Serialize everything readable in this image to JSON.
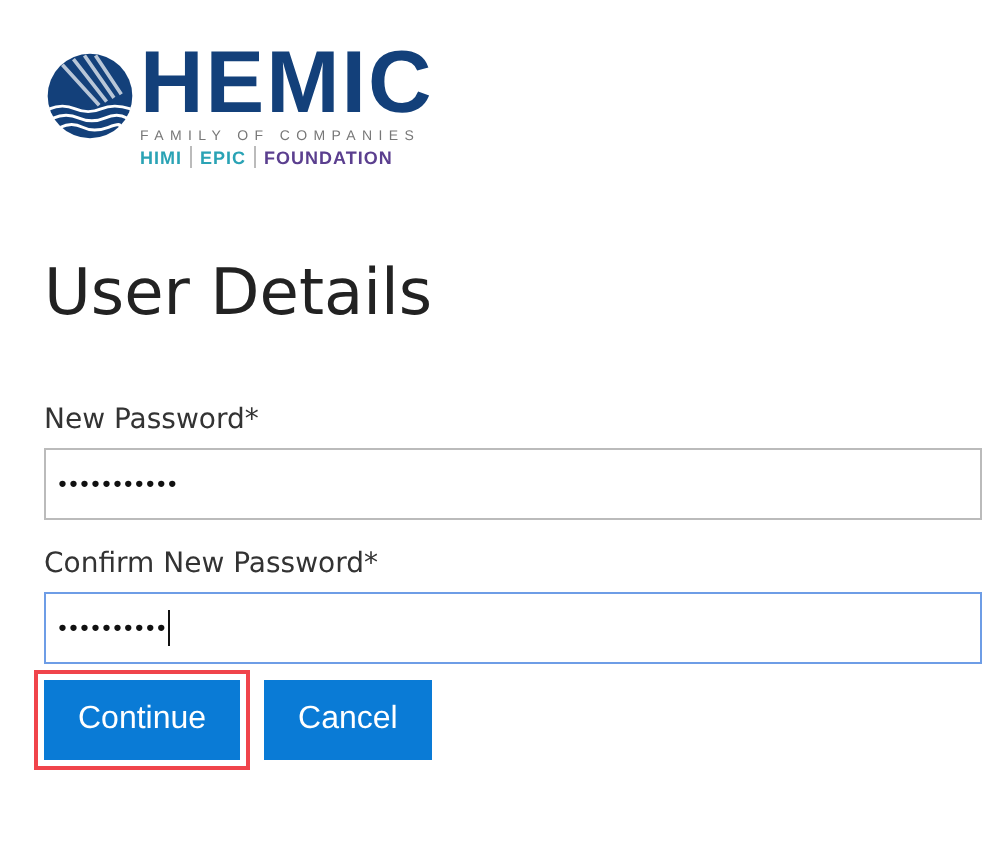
{
  "logo": {
    "name": "HEMIC",
    "tagline": "FAMILY OF COMPANIES",
    "brands": [
      {
        "label": "HIMI",
        "color": "#2aa3b5"
      },
      {
        "label": "EPIC",
        "color": "#2aa3b5"
      },
      {
        "label": "FOUNDATION",
        "color": "#5b3f8f"
      }
    ]
  },
  "title": "User Details",
  "fields": [
    {
      "label": "New Password*",
      "value": "•••••••••••",
      "focused": false
    },
    {
      "label": "Confirm New Password*",
      "value": "••••••••••",
      "focused": true
    }
  ],
  "buttons": [
    {
      "label": "Continue",
      "highlighted": true
    },
    {
      "label": "Cancel",
      "highlighted": false
    }
  ]
}
